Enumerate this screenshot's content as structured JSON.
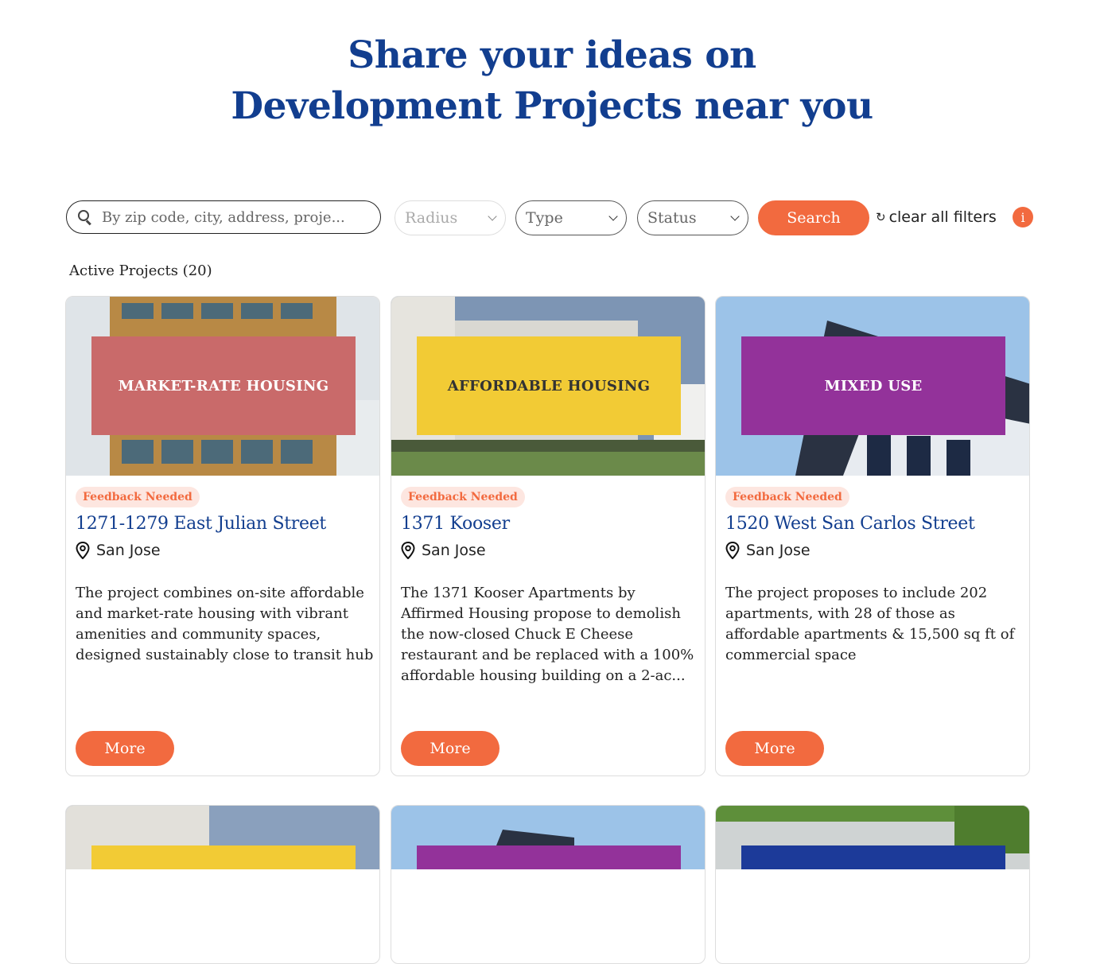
{
  "hero": {
    "line1": "Share your ideas on",
    "line2": "Development Projects near you"
  },
  "filters": {
    "search_placeholder": "By zip code, city, address, proje...",
    "radius_label": "Radius",
    "type_label": "Type",
    "status_label": "Status",
    "search_button": "Search",
    "clear_label": "clear all filters",
    "info_icon_glyph": "i"
  },
  "projects_label": "Active Projects (20)",
  "colors": {
    "accent": "#f26a3f",
    "title_blue": "#123e8f",
    "market_rate": "#c96a6a",
    "affordable": "#f2cb35",
    "mixed_use": "#93329a"
  },
  "cards": [
    {
      "type": "MARKET-RATE HOUSING",
      "status": "Feedback Needed",
      "title": "1271-1279 East Julian Street",
      "city": "San Jose",
      "description": "The project combines on-site affordable and market-rate housing with vibrant amenities and community spaces, designed sustainably close to transit hub",
      "more": "More"
    },
    {
      "type": "AFFORDABLE HOUSING",
      "status": "Feedback Needed",
      "title": "1371 Kooser",
      "city": "San Jose",
      "description": "The 1371 Kooser Apartments by Affirmed Housing propose to demolish the now-closed Chuck E Cheese restaurant and be replaced with a 100% affordable housing building on a 2-ac...",
      "more": "More"
    },
    {
      "type": "MIXED USE",
      "status": "Feedback Needed",
      "title": "1520 West San Carlos Street",
      "city": "San Jose",
      "description": "The project proposes to include 202 apartments, with 28 of those as affordable apartments & 15,500 sq ft of commercial space",
      "more": "More"
    }
  ]
}
